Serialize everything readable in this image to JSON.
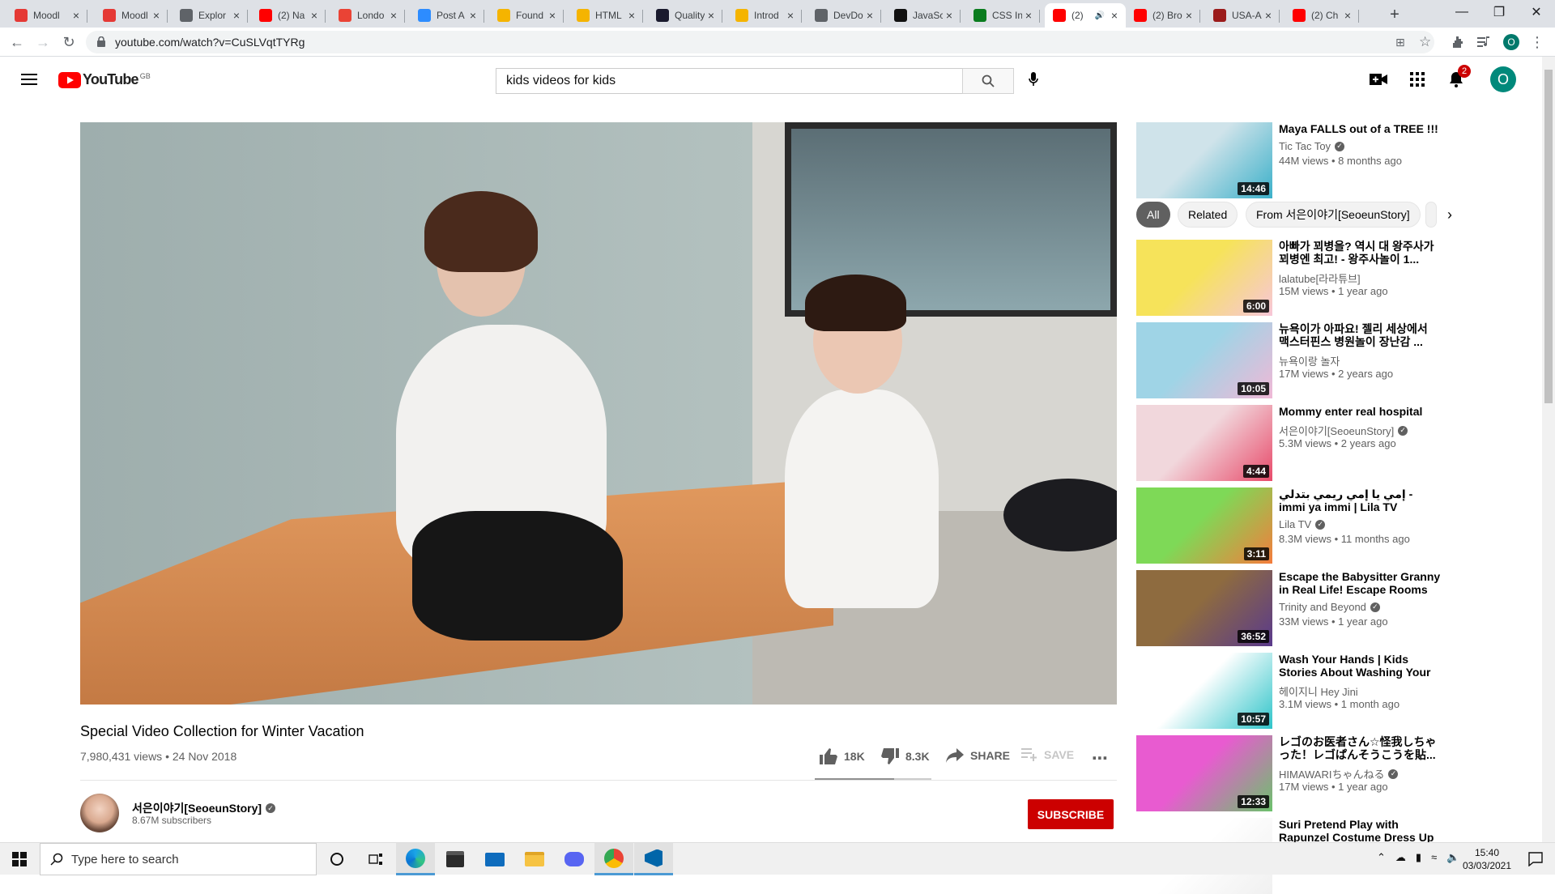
{
  "browser": {
    "tabs": [
      {
        "label": "Moodl",
        "icon": "moodle-icon",
        "color": "#e53935"
      },
      {
        "label": "Moodl",
        "icon": "moodle-icon",
        "color": "#e53935"
      },
      {
        "label": "Explor",
        "icon": "globe-icon",
        "color": "#5f6368"
      },
      {
        "label": "(2) Na",
        "icon": "youtube-icon",
        "color": "#ff0000"
      },
      {
        "label": "Londo",
        "icon": "gmail-icon",
        "color": "#ea4335"
      },
      {
        "label": "Post A",
        "icon": "zoom-icon",
        "color": "#2d8cff"
      },
      {
        "label": "Found",
        "icon": "w3-icon",
        "color": "#f5b400"
      },
      {
        "label": "HTML",
        "icon": "w3-icon",
        "color": "#f5b400"
      },
      {
        "label": "Quality",
        "icon": "a-icon",
        "color": "#1a1a2e"
      },
      {
        "label": "Introd",
        "icon": "w3-icon",
        "color": "#f5b400"
      },
      {
        "label": "DevDo",
        "icon": "search-icon",
        "color": "#5f6368"
      },
      {
        "label": "JavaSc",
        "icon": "js-icon",
        "color": "#111111"
      },
      {
        "label": "CSS In",
        "icon": "w-icon",
        "color": "#0a7c1e"
      },
      {
        "label": "(2)",
        "icon": "youtube-icon",
        "color": "#ff0000",
        "active": true
      },
      {
        "label": "(2) Bro",
        "icon": "youtube-icon",
        "color": "#ff0000"
      },
      {
        "label": "USA-A",
        "icon": "flag-icon",
        "color": "#9b1b1b"
      },
      {
        "label": "(2) Ch",
        "icon": "youtube-icon",
        "color": "#ff0000"
      }
    ],
    "new_tab": "+",
    "url": "youtube.com/watch?v=CuSLVqtTYRg",
    "profile_initial": "O"
  },
  "header": {
    "logo_text": "YouTube",
    "region": "GB",
    "search_value": "kids videos for kids",
    "notifications_count": "2",
    "avatar_initial": "O"
  },
  "video": {
    "title": "Special Video Collection for Winter Vacation",
    "views_date": "7,980,431 views • 24 Nov 2018",
    "likes": "18K",
    "dislikes": "8.3K",
    "share": "SHARE",
    "save": "SAVE",
    "like_ratio": 0.68
  },
  "channel": {
    "name": "서은이야기[SeoeunStory]",
    "subscribers": "8.67M subscribers",
    "subscribe": "SUBSCRIBE"
  },
  "chips": [
    "All",
    "Related",
    "From 서은이야기[SeoeunStory]"
  ],
  "recommendations": [
    {
      "title": "Maya FALLS out of a TREE !!!",
      "channel": "Tic Tac Toy",
      "verified": true,
      "meta": "44M views • 8 months ago",
      "duration": "14:46",
      "thumb": [
        "#cfe3ea",
        "#3bb0c9"
      ]
    },
    {
      "title": "아빠가 꾀병을? 역시 대 왕주사가 꾀병엔 최고! - 왕주사놀이 1...",
      "channel": "lalatube[라라튜브]",
      "verified": false,
      "meta": "15M views • 1 year ago",
      "duration": "6:00",
      "thumb": [
        "#f6e35a",
        "#f7c6d8"
      ]
    },
    {
      "title": "뉴욕이가 아파요! 젤리 세상에서 맥스터핀스 병원놀이 장난감 ...",
      "channel": "뉴욕이랑 놀자",
      "verified": false,
      "meta": "17M views • 2 years ago",
      "duration": "10:05",
      "thumb": [
        "#9fd4e6",
        "#f0b8d6"
      ]
    },
    {
      "title": "Mommy enter real hospital",
      "channel": "서은이야기[SeoeunStory]",
      "verified": true,
      "meta": "5.3M views • 2 years ago",
      "duration": "4:44",
      "thumb": [
        "#f1d7dc",
        "#e84a6a"
      ]
    },
    {
      "title": "إمي يا إمي ريمي بتدلي - immi ya immi | Lila TV",
      "channel": "Lila TV",
      "verified": true,
      "meta": "8.3M views • 11 months ago",
      "duration": "3:11",
      "thumb": [
        "#7ed957",
        "#f47c3c"
      ]
    },
    {
      "title": "Escape the Babysitter Granny in Real Life! Escape Rooms &...",
      "channel": "Trinity and Beyond",
      "verified": true,
      "meta": "33M views • 1 year ago",
      "duration": "36:52",
      "thumb": [
        "#8e6b3f",
        "#5a3a8c"
      ]
    },
    {
      "title": "Wash Your Hands | Kids Stories About Washing Your Hands!",
      "channel": "헤이지니 Hey Jini",
      "verified": false,
      "meta": "3.1M views • 1 month ago",
      "duration": "10:57",
      "thumb": [
        "#ffffff",
        "#2ec4c9"
      ]
    },
    {
      "title": "レゴのお医者さん☆怪我しちゃった！レゴぱんそうこうを貼...",
      "channel": "HIMAWARIちゃんねる",
      "verified": true,
      "meta": "17M views • 1 year ago",
      "duration": "12:33",
      "thumb": [
        "#e85bd0",
        "#6bc26b"
      ]
    },
    {
      "title": "Suri Pretend Play with Rapunzel Costume Dress Up & Getting...",
      "channel": "",
      "verified": false,
      "meta": "",
      "duration": "",
      "thumb": [
        "#ffffff",
        "#f0f0f0"
      ]
    }
  ],
  "taskbar": {
    "search_placeholder": "Type here to search",
    "time": "15:40",
    "date": "03/03/2021"
  }
}
